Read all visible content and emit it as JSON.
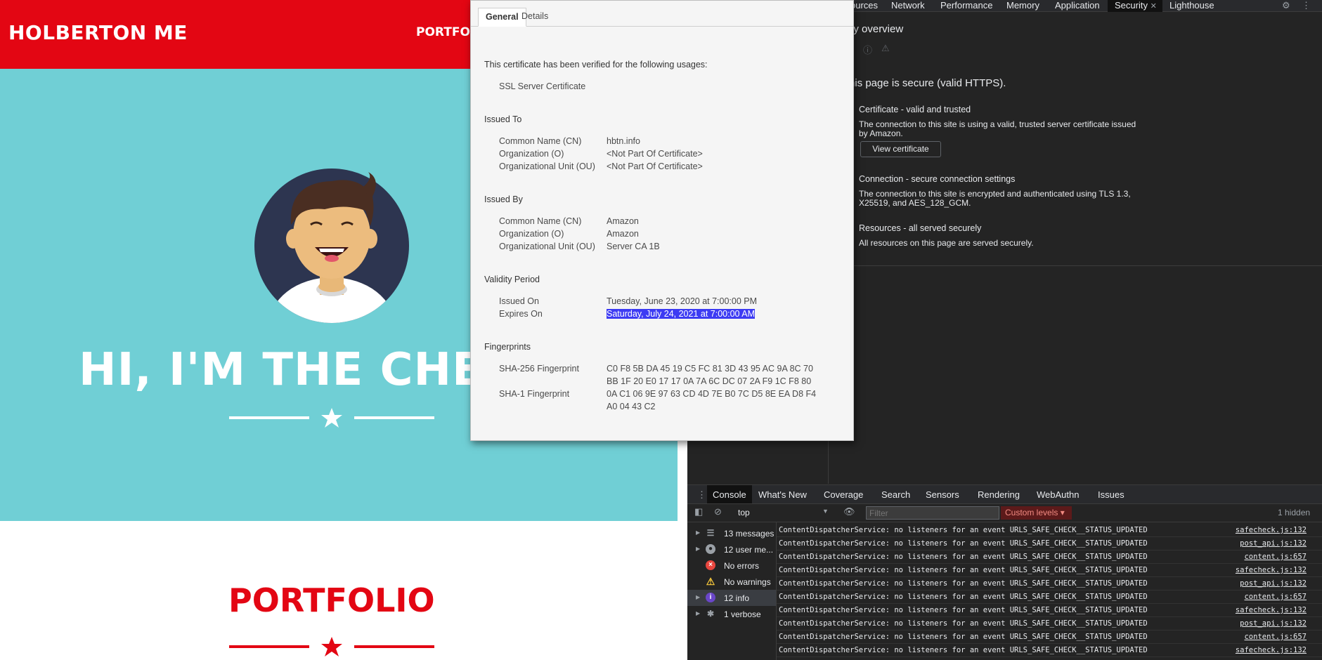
{
  "site": {
    "brand": "HOLBERTON ME",
    "nav_link": "PORTFOLIO",
    "hero_title": "HI, I'M THE CHECKER",
    "portfolio_title": "PORTFOLIO",
    "colors": {
      "red": "#e30613",
      "teal": "#70cfd5",
      "navy": "#2d3550"
    }
  },
  "devtools": {
    "tabs": [
      "ources",
      "Network",
      "Performance",
      "Memory",
      "Application",
      "Security",
      "Lighthouse"
    ],
    "active_tab": "Security",
    "security": {
      "heading": "curity overview",
      "secure_text": "his page is secure (valid HTTPS).",
      "certificate_title": "Certificate - valid and trusted",
      "certificate_text": "The connection to this site is using a valid, trusted server certificate issued by Amazon.",
      "view_certificate": "View certificate",
      "connection_title": "Connection - secure connection settings",
      "connection_text": "The connection to this site is encrypted and authenticated using TLS 1.3, X25519, and AES_128_GCM.",
      "resources_title": "Resources - all served securely",
      "resources_text": "All resources on this page are served securely."
    },
    "drawer_tabs": [
      "Console",
      "What's New",
      "Coverage",
      "Search",
      "Sensors",
      "Rendering",
      "WebAuthn",
      "Issues"
    ],
    "console": {
      "context": "top",
      "filter_placeholder": "Filter",
      "levels": "Custom levels",
      "hidden": "1 hidden",
      "sidebar": [
        {
          "label": "13 messages",
          "icon": "list-icon"
        },
        {
          "label": "12 user me...",
          "icon": "user-icon"
        },
        {
          "label": "No errors",
          "icon": "error-icon"
        },
        {
          "label": "No warnings",
          "icon": "warning-icon"
        },
        {
          "label": "12 info",
          "icon": "info-icon"
        },
        {
          "label": "1 verbose",
          "icon": "bug-icon"
        }
      ],
      "messages": [
        {
          "text": "ContentDispatcherService: no listeners for an event URLS_SAFE_CHECK__STATUS_UPDATED",
          "source": "safecheck.js:132"
        },
        {
          "text": "ContentDispatcherService: no listeners for an event URLS_SAFE_CHECK__STATUS_UPDATED",
          "source": "post_api.js:132"
        },
        {
          "text": "ContentDispatcherService: no listeners for an event URLS_SAFE_CHECK__STATUS_UPDATED",
          "source": "content.js:657"
        },
        {
          "text": "ContentDispatcherService: no listeners for an event URLS_SAFE_CHECK__STATUS_UPDATED",
          "source": "safecheck.js:132"
        },
        {
          "text": "ContentDispatcherService: no listeners for an event URLS_SAFE_CHECK__STATUS_UPDATED",
          "source": "post_api.js:132"
        },
        {
          "text": "ContentDispatcherService: no listeners for an event URLS_SAFE_CHECK__STATUS_UPDATED",
          "source": "content.js:657"
        },
        {
          "text": "ContentDispatcherService: no listeners for an event URLS_SAFE_CHECK__STATUS_UPDATED",
          "source": "safecheck.js:132"
        },
        {
          "text": "ContentDispatcherService: no listeners for an event URLS_SAFE_CHECK__STATUS_UPDATED",
          "source": "post_api.js:132"
        },
        {
          "text": "ContentDispatcherService: no listeners for an event URLS_SAFE_CHECK__STATUS_UPDATED",
          "source": "content.js:657"
        },
        {
          "text": "ContentDispatcherService: no listeners for an event URLS_SAFE_CHECK__STATUS_UPDATED",
          "source": "safecheck.js:132"
        }
      ]
    }
  },
  "certificate": {
    "tabs": [
      "General",
      "Details"
    ],
    "usage_heading": "This certificate has been verified for the following usages:",
    "usage": "SSL Server Certificate",
    "issued_to_heading": "Issued To",
    "issued_to": [
      {
        "label": "Common Name (CN)",
        "value": "hbtn.info"
      },
      {
        "label": "Organization (O)",
        "value": "<Not Part Of Certificate>"
      },
      {
        "label": "Organizational Unit (OU)",
        "value": "<Not Part Of Certificate>"
      }
    ],
    "issued_by_heading": "Issued By",
    "issued_by": [
      {
        "label": "Common Name (CN)",
        "value": "Amazon"
      },
      {
        "label": "Organization (O)",
        "value": "Amazon"
      },
      {
        "label": "Organizational Unit (OU)",
        "value": "Server CA 1B"
      }
    ],
    "validity_heading": "Validity Period",
    "issued_on_label": "Issued On",
    "issued_on": "Tuesday, June 23, 2020 at 7:00:00 PM",
    "expires_on_label": "Expires On",
    "expires_on": "Saturday, July 24, 2021 at 7:00:00 AM",
    "fingerprints_heading": "Fingerprints",
    "sha256_label": "SHA-256 Fingerprint",
    "sha256_line1": "C0 F8 5B DA 45 19 C5 FC 81 3D 43 95 AC 9A 8C 70",
    "sha256_line2": "BB 1F 20 E0 17 17 0A 7A 6C DC 07 2A F9 1C F8 80",
    "sha1_label": "SHA-1 Fingerprint",
    "sha1_line1": "0A C1 06 9E 97 63 CD 4D 7E B0 7C D5 8E EA D8 F4",
    "sha1_line2": "A0 04 43 C2"
  }
}
